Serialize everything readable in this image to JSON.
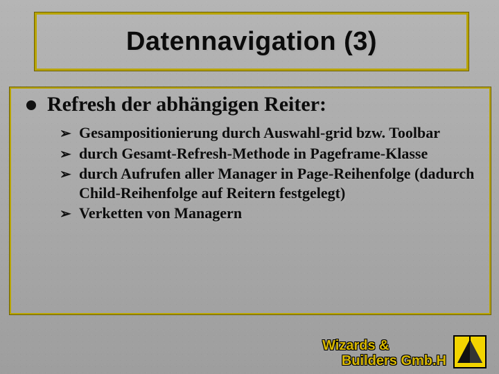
{
  "title": "Datennavigation (3)",
  "heading": "Refresh der abhängigen Reiter:",
  "bullets": [
    "Gesampositionierung durch Auswahl-grid bzw. Toolbar",
    "durch Gesamt-Refresh-Methode in Pageframe-Klasse",
    "durch Aufrufen aller Manager in Page-Reihenfolge (dadurch Child-Reihenfolge auf Reitern festgelegt)",
    "Verketten von Managern"
  ],
  "footer": {
    "line1": "Wizards &",
    "line2": "     Builders Gmb.H"
  }
}
